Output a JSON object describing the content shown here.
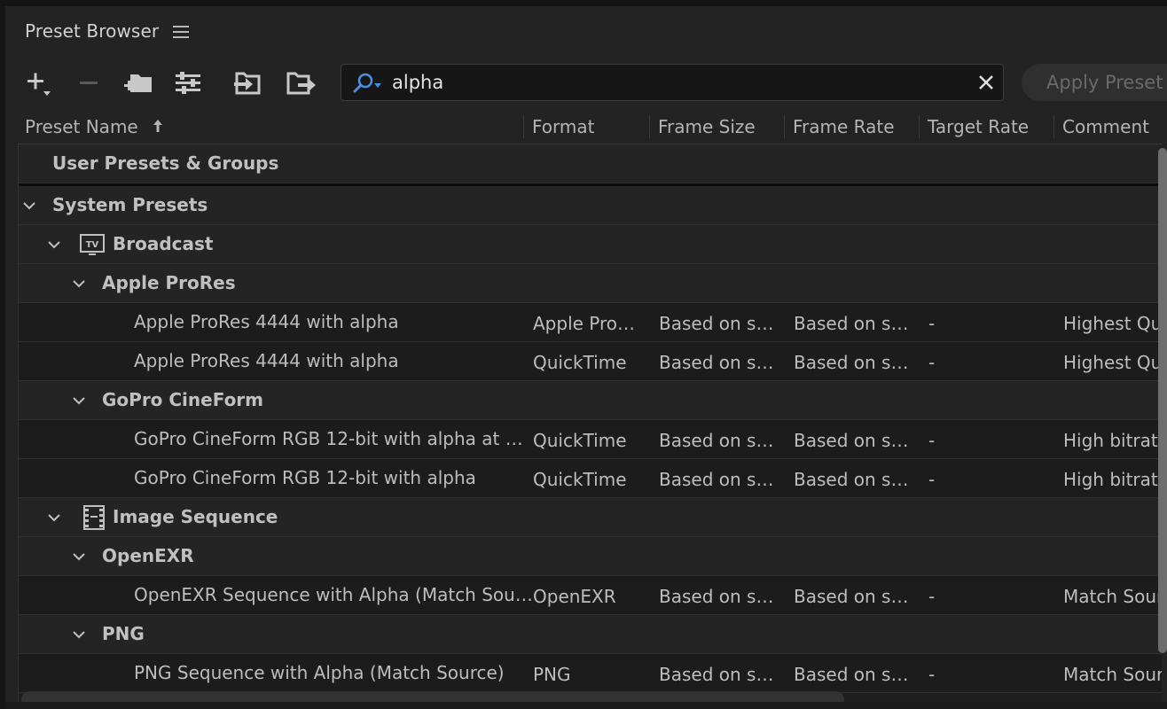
{
  "panel": {
    "title": "Preset Browser"
  },
  "search": {
    "value": "alpha"
  },
  "apply_label": "Apply Preset",
  "columns": {
    "name": "Preset Name",
    "format": "Format",
    "frame_size": "Frame Size",
    "frame_rate": "Frame Rate",
    "target_rate": "Target Rate",
    "comment": "Comment"
  },
  "groups": {
    "user": "User Presets & Groups",
    "system": "System Presets",
    "broadcast": "Broadcast",
    "prores": "Apple ProRes",
    "gopro": "GoPro CineForm",
    "image_seq": "Image Sequence",
    "openexr": "OpenEXR",
    "png": "PNG"
  },
  "presets": [
    {
      "name": "Apple ProRes 4444 with alpha",
      "format": "Apple Pro…",
      "frame_size": "Based on s…",
      "frame_rate": "Based on s…",
      "target_rate": "-",
      "comment": "Highest Qu"
    },
    {
      "name": "Apple ProRes 4444 with alpha",
      "format": "QuickTime",
      "frame_size": "Based on s…",
      "frame_rate": "Based on s…",
      "target_rate": "-",
      "comment": "Highest Qu"
    },
    {
      "name": "GoPro CineForm RGB 12-bit with alpha at …",
      "format": "QuickTime",
      "frame_size": "Based on s…",
      "frame_rate": "Based on s…",
      "target_rate": "-",
      "comment": "High bitrate"
    },
    {
      "name": "GoPro CineForm RGB 12-bit with alpha",
      "format": "QuickTime",
      "frame_size": "Based on s…",
      "frame_rate": "Based on s…",
      "target_rate": "-",
      "comment": "High bitrate"
    },
    {
      "name": "OpenEXR Sequence with Alpha (Match Sou…",
      "format": "OpenEXR",
      "frame_size": "Based on s…",
      "frame_rate": "Based on s…",
      "target_rate": "-",
      "comment": "Match Sour"
    },
    {
      "name": "PNG Sequence with Alpha (Match Source)",
      "format": "PNG",
      "frame_size": "Based on s…",
      "frame_rate": "Based on s…",
      "target_rate": "-",
      "comment": "Match Sour"
    }
  ],
  "icons": {
    "add": "plus-icon",
    "remove": "minus-icon",
    "new_group": "new-group-icon",
    "settings": "preset-settings-icon",
    "import": "import-preset-icon",
    "export": "export-preset-icon",
    "search": "search-icon",
    "clear": "close-icon",
    "broadcast": "tv-icon",
    "image_sequence": "film-strip-icon"
  },
  "colors": {
    "accent": "#4a90e2",
    "background": "#232323"
  }
}
